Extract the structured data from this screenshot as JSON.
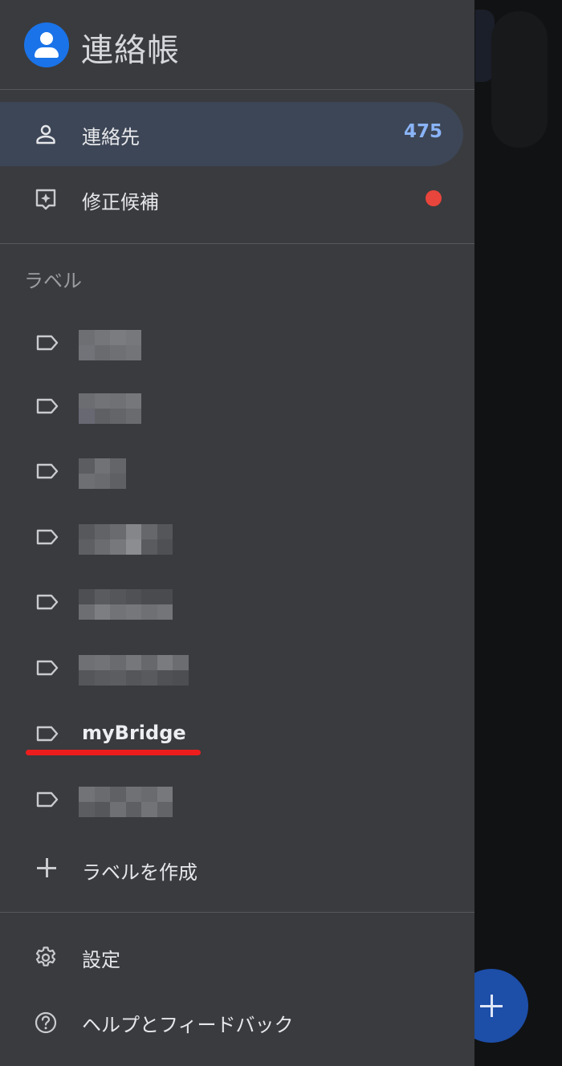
{
  "app": {
    "title": "連絡帳"
  },
  "nav": [
    {
      "label": "連絡先",
      "count": "475",
      "active": true,
      "icon": "person-icon"
    },
    {
      "label": "修正候補",
      "badge": "red-dot",
      "icon": "suggestions-icon"
    }
  ],
  "labels_section": {
    "title": "ラベル",
    "items": [
      {
        "label": "",
        "obscured": true
      },
      {
        "label": "",
        "obscured": true
      },
      {
        "label": "",
        "obscured": true
      },
      {
        "label": "",
        "obscured": true
      },
      {
        "label": "",
        "obscured": true
      },
      {
        "label": "",
        "obscured": true
      },
      {
        "label": "myBridge",
        "obscured": false,
        "highlighted": true
      },
      {
        "label": "",
        "obscured": true
      }
    ],
    "create_label": "ラベルを作成"
  },
  "footer": {
    "settings": "設定",
    "help": "ヘルプとフィードバック"
  },
  "colors": {
    "drawer_bg": "#3a3b3e",
    "active_item_bg": "#3d4656",
    "accent_blue": "#1a73e8",
    "count_blue": "#8ab4f8",
    "badge_red": "#e8453c",
    "annotation_red": "#ee1d1d"
  }
}
